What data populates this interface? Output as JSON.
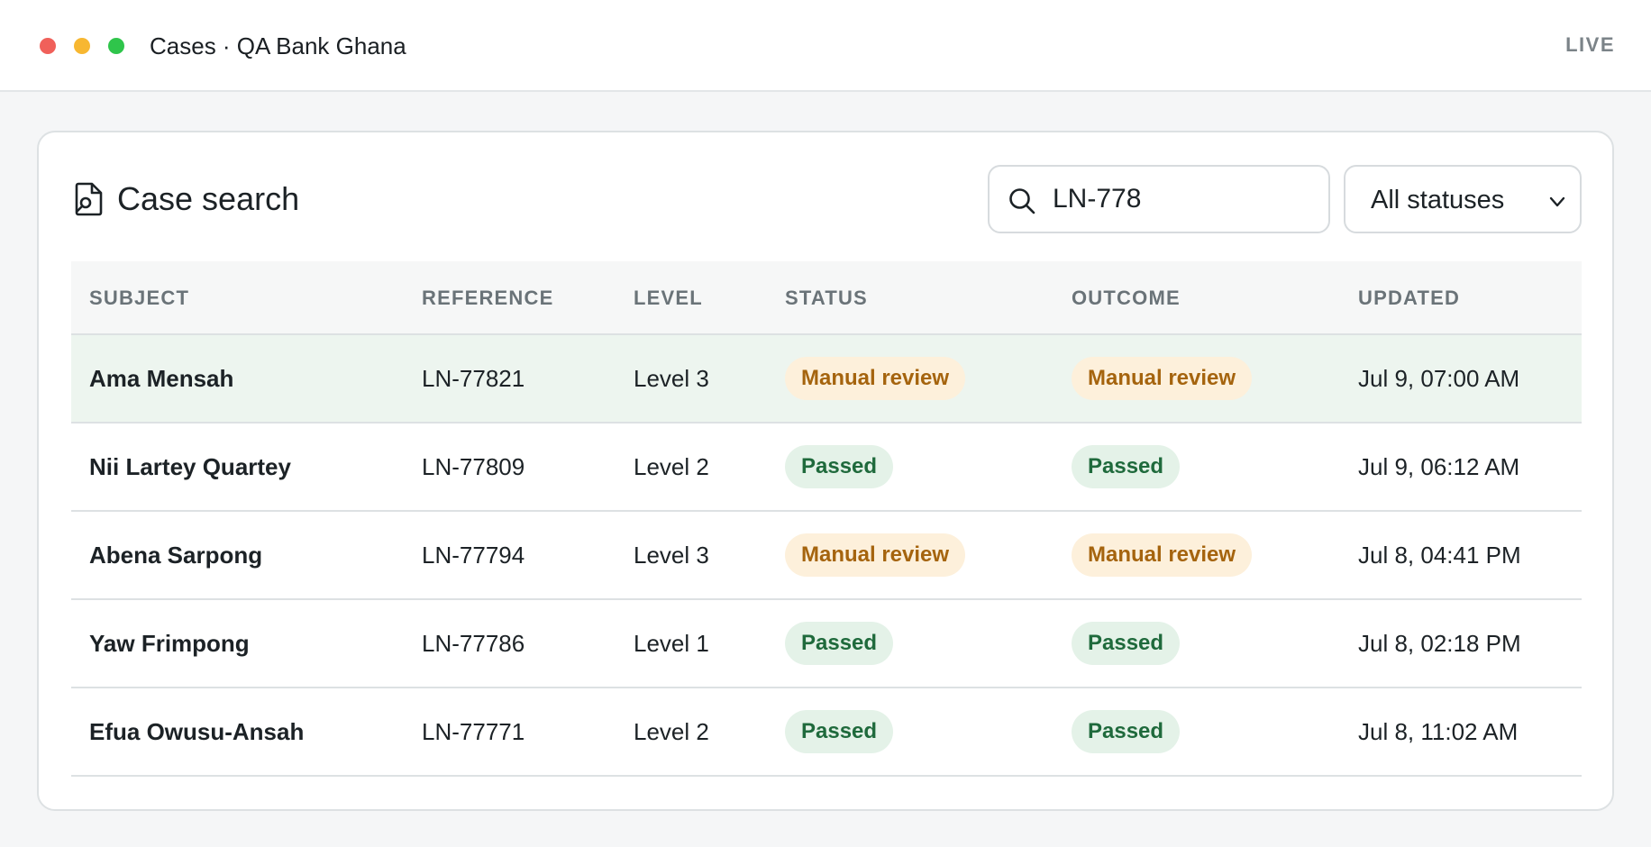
{
  "window": {
    "title": "Cases · QA Bank Ghana",
    "live_label": "LIVE"
  },
  "case_search": {
    "title": "Case search",
    "search_value": "LN-778",
    "status_filter": "All statuses"
  },
  "table": {
    "columns": [
      "SUBJECT",
      "REFERENCE",
      "LEVEL",
      "STATUS",
      "OUTCOME",
      "UPDATED"
    ],
    "rows": [
      {
        "subject": "Ama Mensah",
        "reference": "LN-77821",
        "level": "Level 3",
        "status": "Manual review",
        "outcome": "Manual review",
        "updated": "Jul 9, 07:00 AM",
        "selected": true
      },
      {
        "subject": "Nii Lartey Quartey",
        "reference": "LN-77809",
        "level": "Level 2",
        "status": "Passed",
        "outcome": "Passed",
        "updated": "Jul 9, 06:12 AM",
        "selected": false
      },
      {
        "subject": "Abena Sarpong",
        "reference": "LN-77794",
        "level": "Level 3",
        "status": "Manual review",
        "outcome": "Manual review",
        "updated": "Jul 8, 04:41 PM",
        "selected": false
      },
      {
        "subject": "Yaw Frimpong",
        "reference": "LN-77786",
        "level": "Level 1",
        "status": "Passed",
        "outcome": "Passed",
        "updated": "Jul 8, 02:18 PM",
        "selected": false
      },
      {
        "subject": "Efua Owusu-Ansah",
        "reference": "LN-77771",
        "level": "Level 2",
        "status": "Passed",
        "outcome": "Passed",
        "updated": "Jul 8, 11:02 AM",
        "selected": false
      }
    ]
  },
  "colors": {
    "selected_row": "#edf5ef",
    "review_bg": "#fdf0db",
    "review_text": "#a5640e",
    "passed_bg": "#e4f2e8",
    "passed_text": "#1f6a3c"
  },
  "icons": {
    "case_icon": "document-search-icon",
    "search_icon": "search-icon",
    "select_icon": "chevron-down-icon"
  }
}
